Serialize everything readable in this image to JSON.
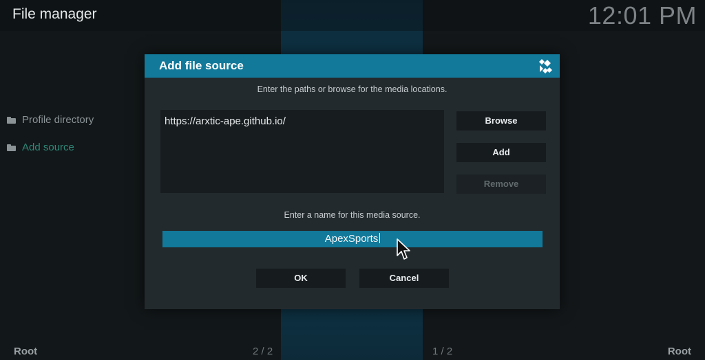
{
  "app": {
    "title": "File manager",
    "clock": "12:01 PM"
  },
  "sidebar": {
    "items": [
      {
        "label": "Profile directory",
        "icon": "folder-icon"
      },
      {
        "label": "Add source",
        "icon": "folder-icon"
      }
    ]
  },
  "footer": {
    "left_root": "Root",
    "left_page": "2 / 2",
    "right_page": "1 / 2",
    "right_root": "Root"
  },
  "dialog": {
    "title": "Add file source",
    "logo_icon": "kodi-logo-icon",
    "paths_hint": "Enter the paths or browse for the media locations.",
    "paths": [
      "https://arxtic-ape.github.io/"
    ],
    "browse_label": "Browse",
    "add_label": "Add",
    "remove_label": "Remove",
    "name_hint": "Enter a name for this media source.",
    "name_value": "ApexSports",
    "ok_label": "OK",
    "cancel_label": "Cancel"
  },
  "colors": {
    "accent": "#12799a",
    "dialog_bg": "#232a2e",
    "highlight_text": "#2f8a7a"
  }
}
